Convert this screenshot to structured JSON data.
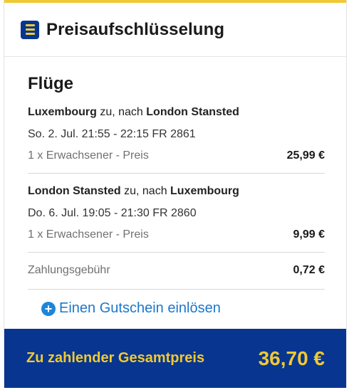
{
  "header": {
    "title": "Preisaufschlüsselung",
    "icon": "list-icon"
  },
  "section": {
    "title": "Flüge"
  },
  "flights": [
    {
      "origin": "Luxembourg",
      "connector": " zu, nach ",
      "destination": "London Stansted",
      "schedule": "So. 2. Jul. 21:55 - 22:15 FR 2861",
      "passenger_label": "1 x Erwachsener - Preis",
      "price": "25,99 €"
    },
    {
      "origin": "London Stansted",
      "connector": " zu, nach ",
      "destination": "Luxembourg",
      "schedule": "Do. 6. Jul. 19:05 - 21:30 FR 2860",
      "passenger_label": "1 x Erwachsener - Preis",
      "price": "9,99 €"
    }
  ],
  "fee": {
    "label": "Zahlungsgebühr",
    "price": "0,72 €"
  },
  "voucher": {
    "label": "Einen Gutschein einlösen",
    "icon": "plus-circle-icon"
  },
  "total": {
    "label": "Zu zahlender Gesamtpreis",
    "value": "36,70 €"
  },
  "colors": {
    "brand_blue": "#073590",
    "brand_yellow": "#f1c933",
    "link_blue": "#1c77c9"
  }
}
